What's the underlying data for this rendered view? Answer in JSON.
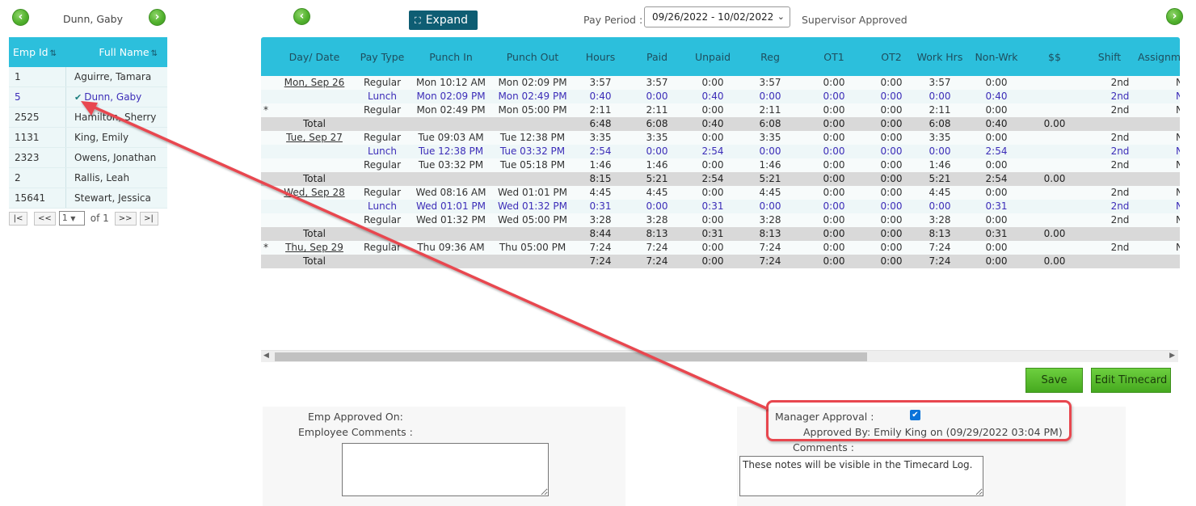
{
  "employee_nav": {
    "name": "Dunn, Gaby",
    "prev_icon": "chevron-left-icon",
    "next_icon": "chevron-right-icon"
  },
  "emp_table": {
    "col_id": "Emp Id",
    "col_name": "Full Name",
    "rows": [
      {
        "id": "1",
        "name": "Aguirre, Tamara"
      },
      {
        "id": "5",
        "name": "Dunn, Gaby"
      },
      {
        "id": "2525",
        "name": "Hamilton, Sherry"
      },
      {
        "id": "1131",
        "name": "King, Emily"
      },
      {
        "id": "2323",
        "name": "Owens, Jonathan"
      },
      {
        "id": "2",
        "name": "Rallis, Leah"
      },
      {
        "id": "15641",
        "name": "Stewart, Jessica"
      }
    ]
  },
  "pager": {
    "first": "|<",
    "prev": "<<",
    "page": "1",
    "of_text": "of 1",
    "next": ">>",
    "last": ">|"
  },
  "topbar": {
    "expand_label": "Expand",
    "pay_period_label": "Pay Period :",
    "pay_period_value": "09/26/2022 - 10/02/2022",
    "status": "Supervisor Approved"
  },
  "grid": {
    "columns": [
      "Day/ Date",
      "Pay Type",
      "Punch In",
      "Punch Out",
      "Hours",
      "Paid",
      "Unpaid",
      "Reg",
      "OT1",
      "OT2",
      "Work Hrs",
      "Non-Wrk",
      "$$",
      "Shift",
      "Assignme"
    ],
    "rows": [
      {
        "star": "",
        "date": "Mon, Sep 26",
        "type": "Regular",
        "in": "Mon 10:12 AM",
        "out": "Mon 02:09 PM",
        "hours": "3:57",
        "paid": "3:57",
        "unpaid": "0:00",
        "reg": "3:57",
        "ot1": "0:00",
        "ot2": "0:00",
        "work": "3:57",
        "nonwrk": "0:00",
        "money": "",
        "shift": "2nd",
        "assign": "N",
        "kind": "regular"
      },
      {
        "star": "",
        "date": "",
        "type": "Lunch",
        "in": "Mon 02:09 PM",
        "out": "Mon 02:49 PM",
        "hours": "0:40",
        "paid": "0:00",
        "unpaid": "0:40",
        "reg": "0:00",
        "ot1": "0:00",
        "ot2": "0:00",
        "work": "0:00",
        "nonwrk": "0:40",
        "money": "",
        "shift": "2nd",
        "assign": "N",
        "kind": "lunch"
      },
      {
        "star": "*",
        "date": "",
        "type": "Regular",
        "in": "Mon 02:49 PM",
        "out": "Mon 05:00 PM",
        "hours": "2:11",
        "paid": "2:11",
        "unpaid": "0:00",
        "reg": "2:11",
        "ot1": "0:00",
        "ot2": "0:00",
        "work": "2:11",
        "nonwrk": "0:00",
        "money": "",
        "shift": "2nd",
        "assign": "N",
        "kind": "regular"
      },
      {
        "star": "",
        "date": "Total",
        "type": "",
        "in": "",
        "out": "",
        "hours": "6:48",
        "paid": "6:08",
        "unpaid": "0:40",
        "reg": "6:08",
        "ot1": "0:00",
        "ot2": "0:00",
        "work": "6:08",
        "nonwrk": "0:40",
        "money": "0.00",
        "shift": "",
        "assign": "",
        "kind": "total"
      },
      {
        "star": "",
        "date": "Tue, Sep 27",
        "type": "Regular",
        "in": "Tue 09:03 AM",
        "out": "Tue 12:38 PM",
        "hours": "3:35",
        "paid": "3:35",
        "unpaid": "0:00",
        "reg": "3:35",
        "ot1": "0:00",
        "ot2": "0:00",
        "work": "3:35",
        "nonwrk": "0:00",
        "money": "",
        "shift": "2nd",
        "assign": "N",
        "kind": "regular"
      },
      {
        "star": "",
        "date": "",
        "type": "Lunch",
        "in": "Tue 12:38 PM",
        "out": "Tue 03:32 PM",
        "hours": "2:54",
        "paid": "0:00",
        "unpaid": "2:54",
        "reg": "0:00",
        "ot1": "0:00",
        "ot2": "0:00",
        "work": "0:00",
        "nonwrk": "2:54",
        "money": "",
        "shift": "2nd",
        "assign": "N",
        "kind": "lunch"
      },
      {
        "star": "",
        "date": "",
        "type": "Regular",
        "in": "Tue 03:32 PM",
        "out": "Tue 05:18 PM",
        "hours": "1:46",
        "paid": "1:46",
        "unpaid": "0:00",
        "reg": "1:46",
        "ot1": "0:00",
        "ot2": "0:00",
        "work": "1:46",
        "nonwrk": "0:00",
        "money": "",
        "shift": "2nd",
        "assign": "N",
        "kind": "regular"
      },
      {
        "star": "",
        "date": "Total",
        "type": "",
        "in": "",
        "out": "",
        "hours": "8:15",
        "paid": "5:21",
        "unpaid": "2:54",
        "reg": "5:21",
        "ot1": "0:00",
        "ot2": "0:00",
        "work": "5:21",
        "nonwrk": "2:54",
        "money": "0.00",
        "shift": "",
        "assign": "",
        "kind": "total"
      },
      {
        "star": "",
        "date": "Wed, Sep 28",
        "type": "Regular",
        "in": "Wed 08:16 AM",
        "out": "Wed 01:01 PM",
        "hours": "4:45",
        "paid": "4:45",
        "unpaid": "0:00",
        "reg": "4:45",
        "ot1": "0:00",
        "ot2": "0:00",
        "work": "4:45",
        "nonwrk": "0:00",
        "money": "",
        "shift": "2nd",
        "assign": "N",
        "kind": "regular"
      },
      {
        "star": "",
        "date": "",
        "type": "Lunch",
        "in": "Wed 01:01 PM",
        "out": "Wed 01:32 PM",
        "hours": "0:31",
        "paid": "0:00",
        "unpaid": "0:31",
        "reg": "0:00",
        "ot1": "0:00",
        "ot2": "0:00",
        "work": "0:00",
        "nonwrk": "0:31",
        "money": "",
        "shift": "2nd",
        "assign": "N",
        "kind": "lunch"
      },
      {
        "star": "",
        "date": "",
        "type": "Regular",
        "in": "Wed 01:32 PM",
        "out": "Wed 05:00 PM",
        "hours": "3:28",
        "paid": "3:28",
        "unpaid": "0:00",
        "reg": "3:28",
        "ot1": "0:00",
        "ot2": "0:00",
        "work": "3:28",
        "nonwrk": "0:00",
        "money": "",
        "shift": "2nd",
        "assign": "N",
        "kind": "regular"
      },
      {
        "star": "",
        "date": "Total",
        "type": "",
        "in": "",
        "out": "",
        "hours": "8:44",
        "paid": "8:13",
        "unpaid": "0:31",
        "reg": "8:13",
        "ot1": "0:00",
        "ot2": "0:00",
        "work": "8:13",
        "nonwrk": "0:31",
        "money": "0.00",
        "shift": "",
        "assign": "",
        "kind": "total"
      },
      {
        "star": "*",
        "date": "Thu, Sep 29",
        "type": "Regular",
        "in": "Thu 09:36 AM",
        "out": "Thu 05:00 PM",
        "hours": "7:24",
        "paid": "7:24",
        "unpaid": "0:00",
        "reg": "7:24",
        "ot1": "0:00",
        "ot2": "0:00",
        "work": "7:24",
        "nonwrk": "0:00",
        "money": "",
        "shift": "2nd",
        "assign": "N",
        "kind": "regular"
      },
      {
        "star": "",
        "date": "Total",
        "type": "",
        "in": "",
        "out": "",
        "hours": "7:24",
        "paid": "7:24",
        "unpaid": "0:00",
        "reg": "7:24",
        "ot1": "0:00",
        "ot2": "0:00",
        "work": "7:24",
        "nonwrk": "0:00",
        "money": "0.00",
        "shift": "",
        "assign": "",
        "kind": "total"
      }
    ]
  },
  "actions": {
    "save": "Save",
    "edit": "Edit Timecard"
  },
  "employee_section": {
    "approved_on_label": "Emp Approved On:",
    "comments_label": "Employee Comments :",
    "comments_value": ""
  },
  "manager_section": {
    "approval_label": "Manager Approval :",
    "approved": true,
    "approved_by": "Approved By: Emily King on (09/29/2022 03:04 PM)",
    "comments_label": "Comments :",
    "comments_value": "These notes will be visible in the Timecard Log."
  },
  "colors": {
    "header": "#2cbfdc",
    "accent_button": "#0e5d73",
    "green_button": "#52b22e",
    "annotation": "#e8474f",
    "lunch_text": "#3c2db8"
  }
}
